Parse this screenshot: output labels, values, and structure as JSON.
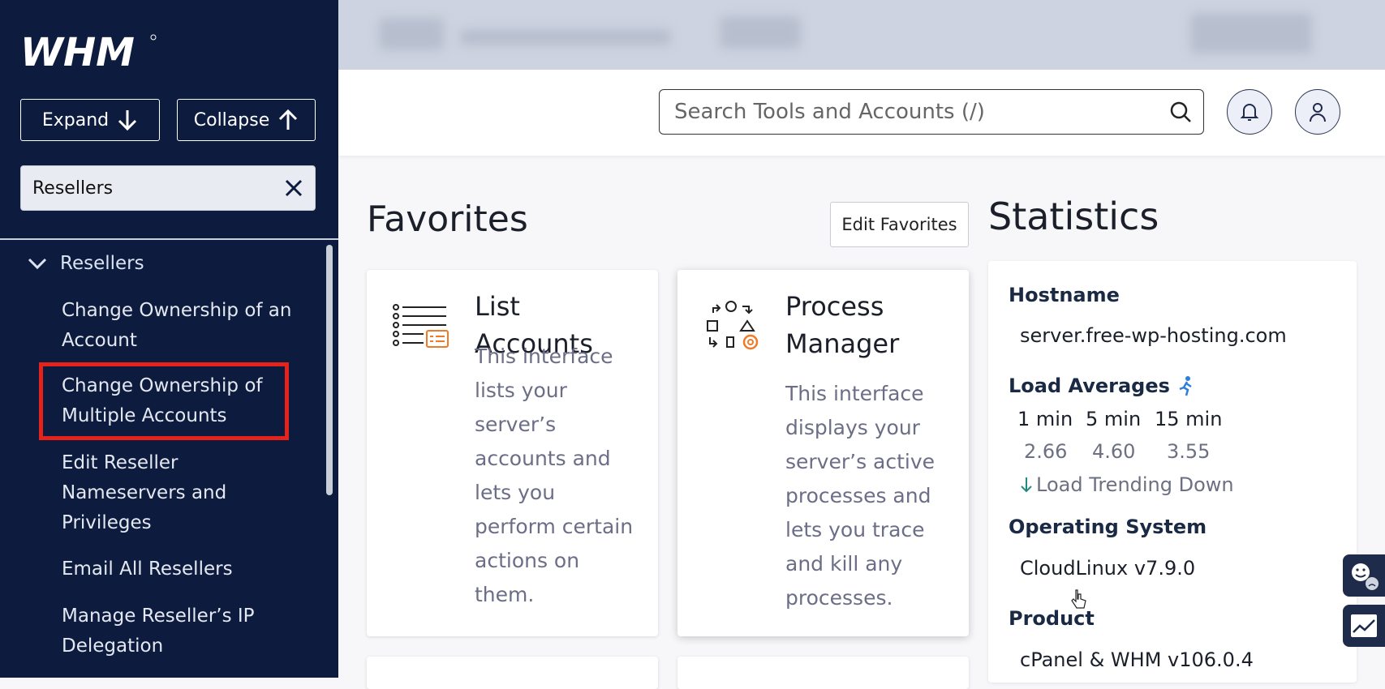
{
  "brand": {
    "logo": "WHM"
  },
  "sidebar": {
    "expand_label": "Expand",
    "collapse_label": "Collapse",
    "search_value": "Resellers",
    "group_label": "Resellers",
    "items": [
      {
        "label": "Change Ownership of an Account"
      },
      {
        "label": "Change Ownership of Multiple Accounts"
      },
      {
        "label": "Edit Reseller Nameservers and Privileges"
      },
      {
        "label": "Email All Resellers"
      },
      {
        "label": "Manage Reseller’s IP Delegation"
      }
    ]
  },
  "header": {
    "search_placeholder": "Search Tools and Accounts (/)"
  },
  "favorites": {
    "title": "Favorites",
    "edit_label": "Edit Favorites",
    "cards": [
      {
        "title": "List Accounts",
        "description": "This interface lists your server’s accounts and lets you perform certain actions on them.",
        "icon": "list-accounts-icon"
      },
      {
        "title": "Process Manager",
        "description": "This interface displays your server’s active processes and lets you trace and kill any processes.",
        "icon": "process-manager-icon"
      }
    ]
  },
  "statistics": {
    "title": "Statistics",
    "hostname_label": "Hostname",
    "hostname": "server.free-wp-hosting.com",
    "load_label": "Load Averages",
    "load_headers": [
      "1 min",
      "5 min",
      "15 min"
    ],
    "load_values": [
      "2.66",
      "4.60",
      "3.55"
    ],
    "load_trend": "Load Trending Down",
    "os_label": "Operating System",
    "os": "CloudLinux v7.9.0",
    "product_label": "Product",
    "product": "cPanel & WHM v106.0.4"
  },
  "colors": {
    "sidebar_bg": "#0d1b3e",
    "highlight": "#e5231b",
    "accent_orange": "#f07a28",
    "accent_blue": "#2f7fd8"
  }
}
